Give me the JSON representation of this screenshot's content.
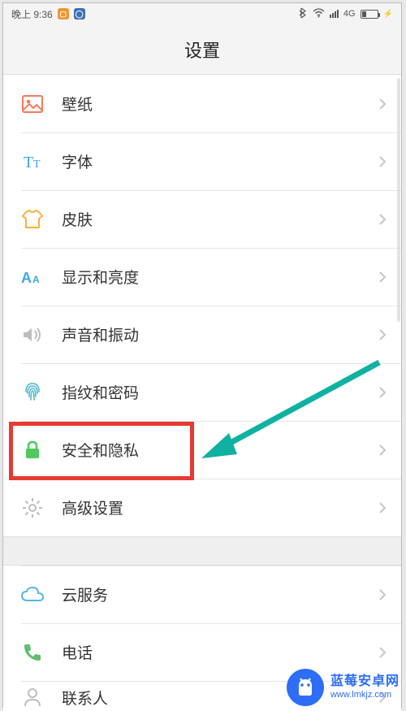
{
  "status": {
    "time": "晚上 9:36",
    "network": "4G"
  },
  "header": {
    "title": "设置"
  },
  "rows": {
    "wallpaper": {
      "label": "壁纸",
      "icon_color": "#f47a5a"
    },
    "font": {
      "label": "字体",
      "icon_color": "#3aa3e3"
    },
    "theme": {
      "label": "皮肤",
      "icon_color": "#f7b23e"
    },
    "display": {
      "label": "显示和亮度",
      "icon_color": "#3fa6e6"
    },
    "sound": {
      "label": "声音和振动",
      "icon_color": "#b8b8b8"
    },
    "fingerprint": {
      "label": "指纹和密码",
      "icon_color": "#4fb6c9"
    },
    "security": {
      "label": "安全和隐私",
      "icon_color": "#4fc95d"
    },
    "advanced": {
      "label": "高级设置",
      "icon_color": "#bdbdbd"
    },
    "cloud": {
      "label": "云服务",
      "icon_color": "#55b8e6"
    },
    "phone": {
      "label": "电话",
      "icon_color": "#5fbf6e"
    },
    "contacts": {
      "label": "联系人",
      "icon_color": "#b8b8b8"
    }
  },
  "highlight": {
    "target": "security",
    "box_color": "#e63b2f",
    "arrow_color": "#0fb1a0"
  },
  "watermark": {
    "line1": "蓝莓安卓网",
    "line2": "www.lmkjz.com",
    "brand_color": "#2e6df6"
  }
}
